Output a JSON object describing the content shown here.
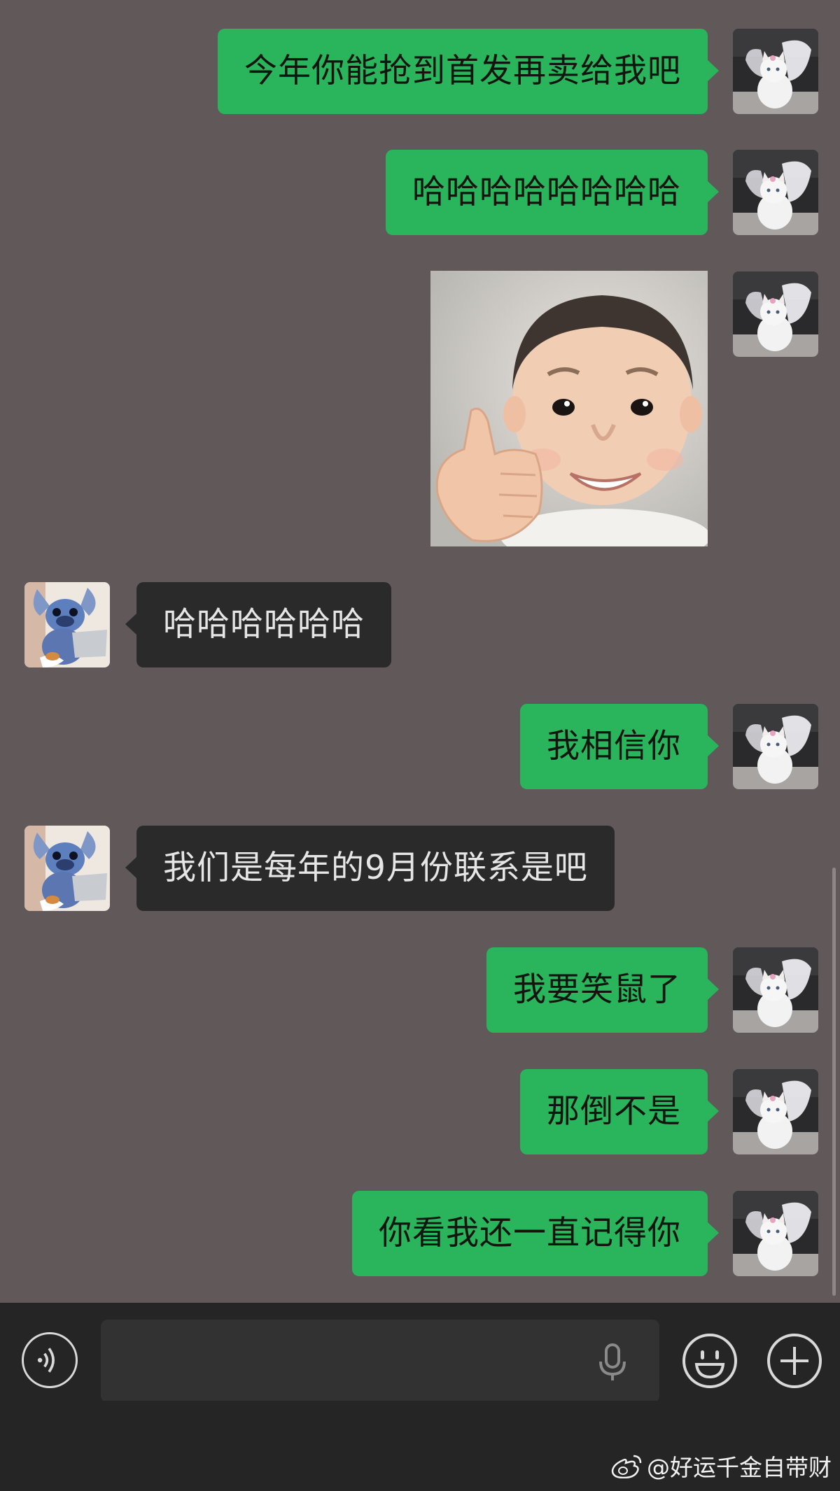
{
  "messages": [
    {
      "side": "me",
      "text": "今年你能抢到首发再卖给我吧"
    },
    {
      "side": "me",
      "text": "哈哈哈哈哈哈哈哈"
    },
    {
      "side": "me",
      "type": "image",
      "icon": "baby-thumbs-up-sticker"
    },
    {
      "side": "them",
      "text": "哈哈哈哈哈哈"
    },
    {
      "side": "me",
      "text": "我相信你"
    },
    {
      "side": "them",
      "text": "我们是每年的9月份联系是吧"
    },
    {
      "side": "me",
      "text": "我要笑鼠了"
    },
    {
      "side": "me",
      "text": "那倒不是"
    },
    {
      "side": "me",
      "text": "你看我还一直记得你"
    }
  ],
  "avatars": {
    "me": "white-kitten-with-wings-avatar",
    "them": "stitch-with-laptop-avatar"
  },
  "input_bar": {
    "voice_icon": "voice-toggle-icon",
    "placeholder": "",
    "mic_icon": "microphone-icon",
    "emoji_icon": "emoji-icon",
    "plus_icon": "plus-icon"
  },
  "watermark": {
    "text": "@好运千金自带财",
    "icon": "weibo-logo-icon"
  },
  "colors": {
    "background": "#615859",
    "my_bubble": "#2ab45b",
    "their_bubble": "#2b2a2b",
    "input_bar": "#262526"
  }
}
